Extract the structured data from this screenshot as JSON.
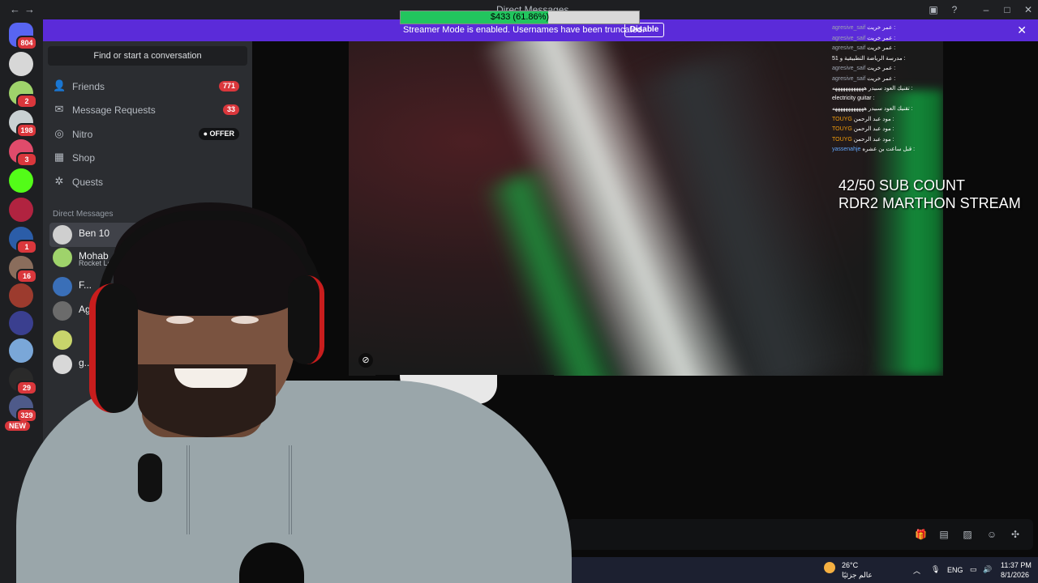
{
  "window": {
    "title": "Direct Messages",
    "back": "←",
    "forward": "→"
  },
  "goal_bar": {
    "label": "$433 (61.86%)",
    "progress_fraction": 0.6186,
    "fill_color": "#22c55e"
  },
  "banner": {
    "text": "Streamer Mode is enabled. Usernames have been truncated.",
    "disable_label": "Disable",
    "close": "✕",
    "color": "#5b2bd9"
  },
  "servers": [
    {
      "badge": "804",
      "color": "#5865f2"
    },
    {
      "badge": "",
      "color": "#d7d7d7"
    },
    {
      "badge": "2",
      "color": "#9fd36b"
    },
    {
      "badge": "198",
      "color": "#c9d1d3"
    },
    {
      "badge": "3",
      "color": "#e04b6b"
    },
    {
      "badge": "",
      "color": "#53fc18"
    },
    {
      "badge": "",
      "color": "#b12340"
    },
    {
      "badge": "1",
      "color": "#2b5da8"
    },
    {
      "badge": "16",
      "color": "#8a6d5c"
    },
    {
      "badge": "",
      "color": "#9c3b2e"
    },
    {
      "badge": "",
      "color": "#3a3f8f"
    },
    {
      "badge": "",
      "color": "#7aa7d8"
    },
    {
      "badge": "29",
      "color": "#2a2a2a"
    },
    {
      "badge": "329",
      "color": "#4e5a8a"
    }
  ],
  "new_badge": "NEW",
  "sidebar": {
    "search_label": "Find or start a conversation",
    "nav": [
      {
        "label": "Friends",
        "count": "771",
        "icon": "friends-icon"
      },
      {
        "label": "Message Requests",
        "count": "33",
        "icon": "mail-icon"
      },
      {
        "label": "Nitro",
        "offer": "OFFER",
        "icon": "nitro-icon"
      },
      {
        "label": "Shop",
        "icon": "shop-icon"
      },
      {
        "label": "Quests",
        "icon": "quests-icon"
      }
    ],
    "section_title": "Direct Messages",
    "dms": [
      {
        "name": "Ben 10",
        "sub": "",
        "color": "#cfcfcf"
      },
      {
        "name": "Mohab",
        "sub": "Rocket Le",
        "color": "#9fd36b"
      },
      {
        "name": "F...",
        "sub": "",
        "color": "#3a6fb8"
      },
      {
        "name": "Aggressive",
        "sub": "",
        "color": "#6b6b6b"
      },
      {
        "name": "",
        "sub": "",
        "color": "#c8d46b"
      },
      {
        "name": "g...",
        "sub": "",
        "color": "#d8d8d8"
      }
    ]
  },
  "overlay": {
    "sub_count": "42/50 SUB COUNT",
    "stream_title": "RDR2 MARTHON STREAM"
  },
  "chat": [
    {
      "user": "agresive_saif",
      "msg": "عمر خريت :"
    },
    {
      "user": "agresive_saif",
      "msg": "عمر خريت :"
    },
    {
      "user": "agresive_saif",
      "msg": "عمر خريت :"
    },
    {
      "user": "",
      "msg": "مدرسة الرياضة التطبيقية و 51 :"
    },
    {
      "user": "agresive_saif",
      "msg": "عمر خريت :"
    },
    {
      "user": "agresive_saif",
      "msg": "عمر خريت :"
    },
    {
      "user": "",
      "msg": "تقنيك العود سبيدر ههههههههههههه :"
    },
    {
      "user": "",
      "msg": "electricity guitar :"
    },
    {
      "user": "",
      "msg": "تقنيك العود سبيدر ههههههههههههه :"
    },
    {
      "user": "TOUYG",
      "msg": "مود عبد الرحمن :"
    },
    {
      "user": "TOUYG",
      "msg": "مود عبد الرحمن :"
    },
    {
      "user": "TOUYG",
      "msg": "مود عبد الرحمن :"
    },
    {
      "user": "yassenahje",
      "msg": "قبل ساعت بن عشره :"
    }
  ],
  "taskbar": {
    "temperature": "26°C",
    "weather_desc": "عالم جزئيًا",
    "language": "ENG",
    "time": "11:37 PM",
    "date": "8/1/2026"
  },
  "message_bar_icons": [
    "gift-icon",
    "gif-icon",
    "sticker-icon",
    "emoji-icon",
    "apps-icon"
  ]
}
